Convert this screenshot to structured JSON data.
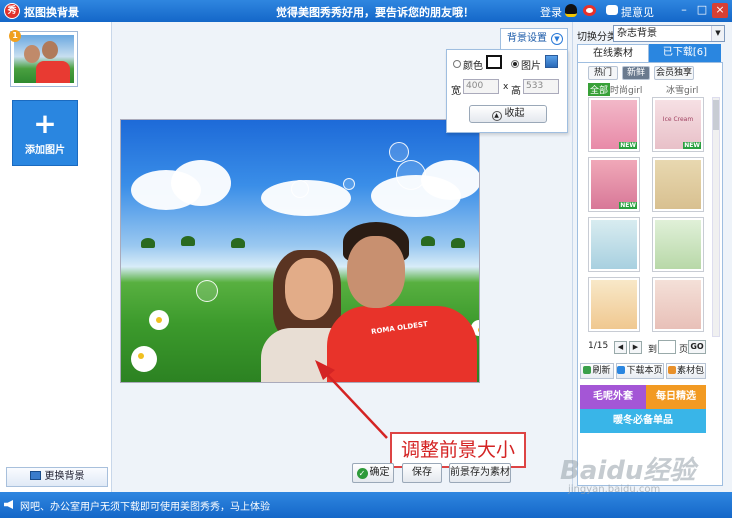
{
  "window": {
    "title": "抠图换背景",
    "marquee": "觉得美图秀秀好用，要告诉您的朋友哦！",
    "login": "登录",
    "feedback": "提意见"
  },
  "left_panel": {
    "thumb_badge": "1",
    "add_image": "添加图片",
    "change_background": "更换背景"
  },
  "bg_settings": {
    "tab_label": "背景设置",
    "color_label": "颜色",
    "image_label": "图片",
    "width_label": "宽",
    "width_value": "400",
    "x_label": "x",
    "height_label": "高",
    "height_value": "533",
    "collapse_label": "收起"
  },
  "photo": {
    "shirt_text": "ROMA OLDEST"
  },
  "annotation": {
    "text": "调整前景大小"
  },
  "actions": {
    "confirm": "确定",
    "save": "保存",
    "save_as_material": "前景存为素材"
  },
  "right_panel": {
    "category_label": "切换分类",
    "category_value": "杂志背景",
    "tab_online": "在线素材",
    "tab_downloaded": "已下载[6]",
    "sub_hot": "热门",
    "sub_new": "新鲜",
    "sub_vip": "会员独享",
    "filter_all": "全部",
    "filter_fashion": "时尚girl",
    "filter_snow": "冰雪girl",
    "new_badge": "NEW",
    "tile_text": "Ice Cream",
    "pager": "1/15",
    "pager_to": "到",
    "pager_page": "页",
    "pager_go": "GO",
    "refresh": "刷新",
    "download_page": "下载本页",
    "material_pack": "素材包",
    "promo_1": "毛呢外套",
    "promo_2": "每日精选",
    "promo_3": "暖冬必备单品"
  },
  "status": {
    "message": "网吧、办公室用户无须下载即可使用美图秀秀，马上体验"
  },
  "watermark": {
    "text": "Baidu经验",
    "sub": "jingyan.baidu.com"
  },
  "colors": {
    "title_bar": "#1d74d8",
    "accent_blue": "#2a86e0",
    "callout_red": "#d42424",
    "promo_purple": "#a456d6",
    "promo_orange": "#f29a22",
    "promo_cyan": "#39b5e8"
  }
}
